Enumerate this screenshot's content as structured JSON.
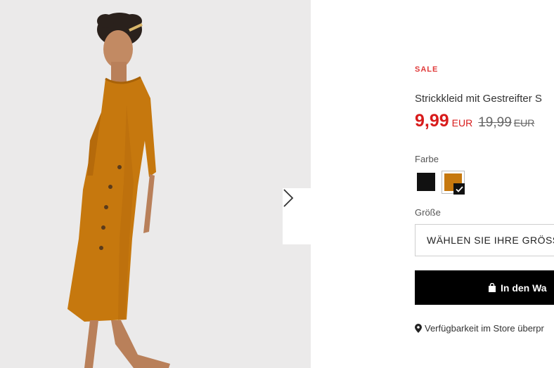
{
  "product": {
    "sale_tag": "SALE",
    "title": "Strickkleid mit Gestreifter S",
    "price_current": "9,99",
    "price_current_currency": "EUR",
    "price_old": "19,99",
    "price_old_currency": "EUR"
  },
  "color": {
    "label": "Farbe",
    "swatches": [
      {
        "name": "black",
        "hex": "#111111",
        "selected": false
      },
      {
        "name": "mustard",
        "hex": "#c6780e",
        "selected": true
      }
    ]
  },
  "size": {
    "label": "Größe",
    "placeholder": "WÄHLEN SIE IHRE GRÖSS"
  },
  "cart": {
    "label": "In den Wa",
    "icon": "shopping-bag-icon"
  },
  "store": {
    "label": "Verfügbarkeit im Store überpr",
    "icon": "map-pin-icon"
  },
  "gallery": {
    "next_icon": "chevron-right-icon",
    "dress_color": "#c6780e",
    "background": "#ebeaea"
  }
}
